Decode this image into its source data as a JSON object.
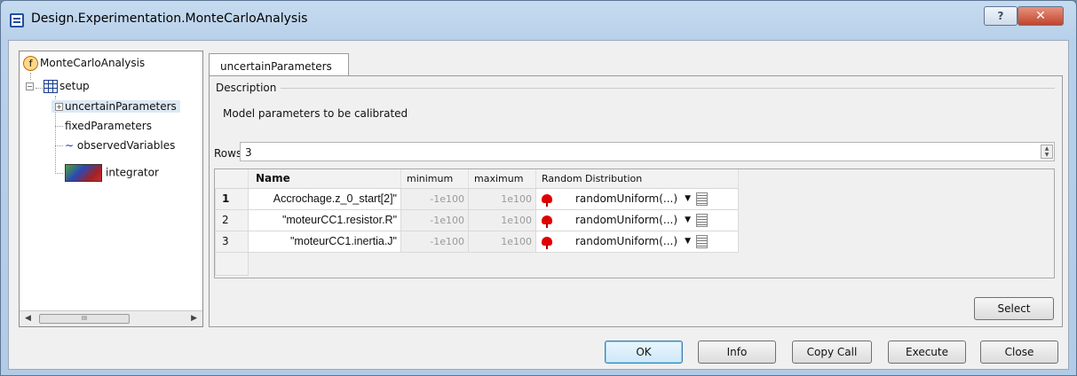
{
  "window": {
    "title": "Design.Experimentation.MonteCarloAnalysis",
    "help_glyph": "?",
    "close_glyph": "✕"
  },
  "tree": {
    "root": {
      "icon_glyph": "f",
      "label": "MonteCarloAnalysis"
    },
    "setup": {
      "label": "setup"
    },
    "children": [
      "uncertainParameters",
      "fixedParameters",
      "observedVariables"
    ],
    "integrator": "integrator",
    "scroll_glyphs": {
      "left": "◀",
      "right": "▶",
      "thumb": "III"
    }
  },
  "tab": {
    "label": "uncertainParameters"
  },
  "description": {
    "label": "Description",
    "text": "Model parameters to be calibrated"
  },
  "rows": {
    "label": "Rows",
    "value": "3"
  },
  "table": {
    "columns": [
      "Name",
      "minimum",
      "maximum",
      "Random Distribution"
    ],
    "rows": [
      {
        "index": "1",
        "name": "Accrochage.z_0_start[2]\"",
        "minimum": "-1e100",
        "maximum": "1e100",
        "distribution": "randomUniform(...)"
      },
      {
        "index": "2",
        "name": "\"moteurCC1.resistor.R\"",
        "minimum": "-1e100",
        "maximum": "1e100",
        "distribution": "randomUniform(...)"
      },
      {
        "index": "3",
        "name": "\"moteurCC1.inertia.J\"",
        "minimum": "-1e100",
        "maximum": "1e100",
        "distribution": "randomUniform(...)"
      }
    ]
  },
  "buttons": {
    "select": "Select",
    "ok": "OK",
    "info": "Info",
    "copy_call": "Copy Call",
    "execute": "Execute",
    "close": "Close"
  }
}
